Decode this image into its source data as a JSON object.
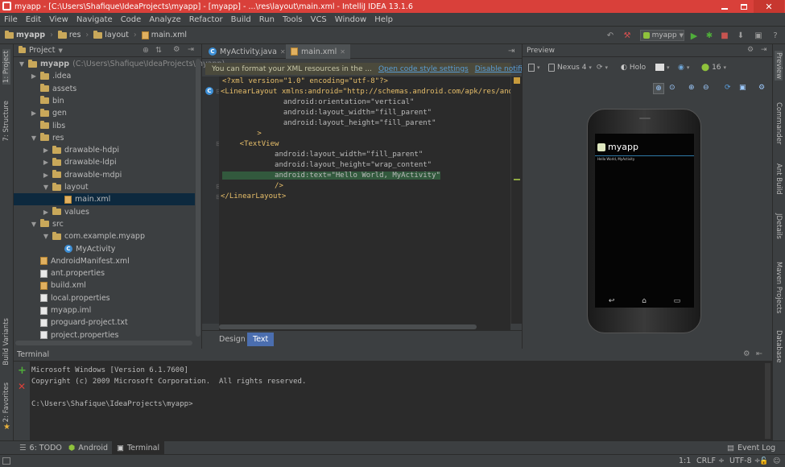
{
  "window": {
    "title": "myapp - [C:\\Users\\Shafique\\IdeaProjects\\myapp] - [myapp] - ...\\res\\layout\\main.xml - IntelliJ IDEA 13.1.6"
  },
  "menu": [
    "File",
    "Edit",
    "View",
    "Navigate",
    "Code",
    "Analyze",
    "Refactor",
    "Build",
    "Run",
    "Tools",
    "VCS",
    "Window",
    "Help"
  ],
  "breadcrumbs": [
    "myapp",
    "res",
    "layout",
    "main.xml"
  ],
  "run_config": "myapp",
  "project_panel": {
    "header": "Project",
    "tree": [
      {
        "label": "myapp",
        "suffix": "(C:\\Users\\Shafique\\IdeaProjects\\myapp)",
        "depth": 0,
        "arrow": "▼",
        "icon": "folder"
      },
      {
        "label": ".idea",
        "depth": 1,
        "arrow": "▶",
        "icon": "folder"
      },
      {
        "label": "assets",
        "depth": 1,
        "arrow": "",
        "icon": "folder"
      },
      {
        "label": "bin",
        "depth": 1,
        "arrow": "",
        "icon": "folder"
      },
      {
        "label": "gen",
        "depth": 1,
        "arrow": "▶",
        "icon": "folder"
      },
      {
        "label": "libs",
        "depth": 1,
        "arrow": "",
        "icon": "folder"
      },
      {
        "label": "res",
        "depth": 1,
        "arrow": "▼",
        "icon": "folder"
      },
      {
        "label": "drawable-hdpi",
        "depth": 2,
        "arrow": "▶",
        "icon": "folder"
      },
      {
        "label": "drawable-ldpi",
        "depth": 2,
        "arrow": "▶",
        "icon": "folder"
      },
      {
        "label": "drawable-mdpi",
        "depth": 2,
        "arrow": "▶",
        "icon": "folder"
      },
      {
        "label": "layout",
        "depth": 2,
        "arrow": "▼",
        "icon": "folder"
      },
      {
        "label": "main.xml",
        "depth": 3,
        "arrow": "",
        "icon": "xml",
        "selected": true
      },
      {
        "label": "values",
        "depth": 2,
        "arrow": "▶",
        "icon": "folder"
      },
      {
        "label": "src",
        "depth": 1,
        "arrow": "▼",
        "icon": "folder"
      },
      {
        "label": "com.example.myapp",
        "depth": 2,
        "arrow": "▼",
        "icon": "folder"
      },
      {
        "label": "MyActivity",
        "depth": 3,
        "arrow": "",
        "icon": "class"
      },
      {
        "label": "AndroidManifest.xml",
        "depth": 1,
        "arrow": "",
        "icon": "xml"
      },
      {
        "label": "ant.properties",
        "depth": 1,
        "arrow": "",
        "icon": "file"
      },
      {
        "label": "build.xml",
        "depth": 1,
        "arrow": "",
        "icon": "xml"
      },
      {
        "label": "local.properties",
        "depth": 1,
        "arrow": "",
        "icon": "file"
      },
      {
        "label": "myapp.iml",
        "depth": 1,
        "arrow": "",
        "icon": "file"
      },
      {
        "label": "proguard-project.txt",
        "depth": 1,
        "arrow": "",
        "icon": "file"
      },
      {
        "label": "project.properties",
        "depth": 1,
        "arrow": "",
        "icon": "file"
      }
    ]
  },
  "editor": {
    "tabs": [
      {
        "label": "MyActivity.java",
        "active": false
      },
      {
        "label": "main.xml",
        "active": true
      }
    ],
    "notice": {
      "text": "You can format your XML resources in the ...",
      "link1": "Open code style settings",
      "link2": "Disable notification"
    },
    "lines": [
      "<?xml version=\"1.0\" encoding=\"utf-8\"?>",
      "<LinearLayout xmlns:android=\"http://schemas.android.com/apk/res/and",
      "              android:orientation=\"vertical\"",
      "              android:layout_width=\"fill_parent\"",
      "              android:layout_height=\"fill_parent\"",
      "        >",
      "    <TextView",
      "            android:layout_width=\"fill_parent\"",
      "            android:layout_height=\"wrap_content\"",
      "            android:text=\"Hello World, MyActivity\"",
      "            />",
      "</LinearLayout>"
    ],
    "bottom_tabs": [
      {
        "label": "Design",
        "active": false
      },
      {
        "label": "Text",
        "active": true
      }
    ]
  },
  "preview": {
    "header": "Preview",
    "device": "Nexus 4",
    "theme": "Holo",
    "api": "16",
    "app_title": "myapp",
    "app_text": "Hello World, MyActivity"
  },
  "terminal": {
    "header": "Terminal",
    "lines": [
      "Microsoft Windows [Version 6.1.7600]",
      "Copyright (c) 2009 Microsoft Corporation.  All rights reserved.",
      "",
      "C:\\Users\\Shafique\\IdeaProjects\\myapp>"
    ]
  },
  "side_tabs": {
    "left": [
      "1: Project",
      "7: Structure",
      "Build Variants",
      "2: Favorites"
    ],
    "right": [
      "Preview",
      "Commander",
      "Ant Build",
      "JDetails",
      "Maven Projects",
      "Database"
    ]
  },
  "bottom_tool_tabs": [
    {
      "label": "6: TODO",
      "active": false
    },
    {
      "label": "Android",
      "active": false
    },
    {
      "label": "Terminal",
      "active": true
    }
  ],
  "status": {
    "event_log": "Event Log",
    "position": "1:1",
    "line_sep": "CRLF ÷",
    "encoding": "UTF-8 ÷"
  },
  "colors": {
    "titlebar": "#d9403a",
    "editor_bg": "#2b2b2b",
    "panel_bg": "#3c3f41",
    "selection": "#0d293e",
    "accent": "#4b6eaf",
    "run": "#4fae3a"
  }
}
